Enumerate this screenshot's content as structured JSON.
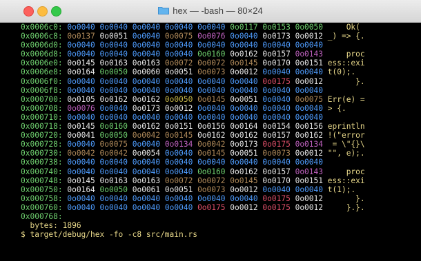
{
  "window": {
    "title": "hex — -bash — 80×24"
  },
  "rows": [
    {
      "addr": "0x0006c0:",
      "bytes": [
        [
          "0o0040",
          "b"
        ],
        [
          "0o0040",
          "b"
        ],
        [
          "0o0040",
          "b"
        ],
        [
          "0o0040",
          "b"
        ],
        [
          "0o0040",
          "b"
        ],
        [
          "0o0117",
          "g"
        ],
        [
          "0o0153",
          "g"
        ],
        [
          "0o0050",
          "g"
        ]
      ],
      "ascii": "    Ok("
    },
    {
      "addr": "0x0006c8:",
      "bytes": [
        [
          "0o0137",
          "o"
        ],
        [
          "0o0051",
          "w"
        ],
        [
          "0o0040",
          "b"
        ],
        [
          "0o0075",
          "o"
        ],
        [
          "0o0076",
          "m"
        ],
        [
          "0o0040",
          "b"
        ],
        [
          "0o0173",
          "w"
        ],
        [
          "0o0012",
          "w"
        ]
      ],
      "ascii": "_) => {."
    },
    {
      "addr": "0x0006d0:",
      "bytes": [
        [
          "0o0040",
          "b"
        ],
        [
          "0o0040",
          "b"
        ],
        [
          "0o0040",
          "b"
        ],
        [
          "0o0040",
          "b"
        ],
        [
          "0o0040",
          "b"
        ],
        [
          "0o0040",
          "b"
        ],
        [
          "0o0040",
          "b"
        ],
        [
          "0o0040",
          "b"
        ]
      ],
      "ascii": ""
    },
    {
      "addr": "0x0006d8:",
      "bytes": [
        [
          "0o0040",
          "b"
        ],
        [
          "0o0040",
          "b"
        ],
        [
          "0o0040",
          "b"
        ],
        [
          "0o0040",
          "b"
        ],
        [
          "0o0160",
          "g"
        ],
        [
          "0o0162",
          "w"
        ],
        [
          "0o0157",
          "w"
        ],
        [
          "0o0143",
          "m"
        ]
      ],
      "ascii": "    proc"
    },
    {
      "addr": "0x0006e0:",
      "bytes": [
        [
          "0o0145",
          "w"
        ],
        [
          "0o0163",
          "w"
        ],
        [
          "0o0163",
          "w"
        ],
        [
          "0o0072",
          "o"
        ],
        [
          "0o0072",
          "o"
        ],
        [
          "0o0145",
          "o"
        ],
        [
          "0o0170",
          "w"
        ],
        [
          "0o0151",
          "w"
        ]
      ],
      "ascii": "ess::exi"
    },
    {
      "addr": "0x0006e8:",
      "bytes": [
        [
          "0o0164",
          "w"
        ],
        [
          "0o0050",
          "g"
        ],
        [
          "0o0060",
          "w"
        ],
        [
          "0o0051",
          "w"
        ],
        [
          "0o0073",
          "o"
        ],
        [
          "0o0012",
          "w"
        ],
        [
          "0o0040",
          "b"
        ],
        [
          "0o0040",
          "b"
        ]
      ],
      "ascii": "t(0);.  "
    },
    {
      "addr": "0x0006f0:",
      "bytes": [
        [
          "0o0040",
          "b"
        ],
        [
          "0o0040",
          "b"
        ],
        [
          "0o0040",
          "b"
        ],
        [
          "0o0040",
          "b"
        ],
        [
          "0o0040",
          "b"
        ],
        [
          "0o0040",
          "b"
        ],
        [
          "0o0175",
          "r"
        ],
        [
          "0o0012",
          "w"
        ]
      ],
      "ascii": "      }."
    },
    {
      "addr": "0x0006f8:",
      "bytes": [
        [
          "0o0040",
          "b"
        ],
        [
          "0o0040",
          "b"
        ],
        [
          "0o0040",
          "b"
        ],
        [
          "0o0040",
          "b"
        ],
        [
          "0o0040",
          "b"
        ],
        [
          "0o0040",
          "b"
        ],
        [
          "0o0040",
          "b"
        ],
        [
          "0o0040",
          "b"
        ]
      ],
      "ascii": ""
    },
    {
      "addr": "0x000700:",
      "bytes": [
        [
          "0o0105",
          "w"
        ],
        [
          "0o0162",
          "w"
        ],
        [
          "0o0162",
          "w"
        ],
        [
          "0o0050",
          "y"
        ],
        [
          "0o0145",
          "o"
        ],
        [
          "0o0051",
          "w"
        ],
        [
          "0o0040",
          "b"
        ],
        [
          "0o0075",
          "o"
        ]
      ],
      "ascii": "Err(e) ="
    },
    {
      "addr": "0x000708:",
      "bytes": [
        [
          "0o0076",
          "m"
        ],
        [
          "0o0040",
          "b"
        ],
        [
          "0o0173",
          "w"
        ],
        [
          "0o0012",
          "w"
        ],
        [
          "0o0040",
          "b"
        ],
        [
          "0o0040",
          "b"
        ],
        [
          "0o0040",
          "b"
        ],
        [
          "0o0040",
          "b"
        ]
      ],
      "ascii": "> {.    "
    },
    {
      "addr": "0x000710:",
      "bytes": [
        [
          "0o0040",
          "b"
        ],
        [
          "0o0040",
          "b"
        ],
        [
          "0o0040",
          "b"
        ],
        [
          "0o0040",
          "b"
        ],
        [
          "0o0040",
          "b"
        ],
        [
          "0o0040",
          "b"
        ],
        [
          "0o0040",
          "b"
        ],
        [
          "0o0040",
          "b"
        ]
      ],
      "ascii": ""
    },
    {
      "addr": "0x000718:",
      "bytes": [
        [
          "0o0145",
          "w"
        ],
        [
          "0o0160",
          "g"
        ],
        [
          "0o0162",
          "w"
        ],
        [
          "0o0151",
          "w"
        ],
        [
          "0o0156",
          "w"
        ],
        [
          "0o0164",
          "w"
        ],
        [
          "0o0154",
          "w"
        ],
        [
          "0o0156",
          "w"
        ]
      ],
      "ascii": "eprintln"
    },
    {
      "addr": "0x000720:",
      "bytes": [
        [
          "0o0041",
          "w"
        ],
        [
          "0o0050",
          "g"
        ],
        [
          "0o0042",
          "o"
        ],
        [
          "0o0145",
          "o"
        ],
        [
          "0o0162",
          "w"
        ],
        [
          "0o0162",
          "w"
        ],
        [
          "0o0157",
          "w"
        ],
        [
          "0o0162",
          "w"
        ]
      ],
      "ascii": "!(\"error"
    },
    {
      "addr": "0x000728:",
      "bytes": [
        [
          "0o0040",
          "b"
        ],
        [
          "0o0075",
          "o"
        ],
        [
          "0o0040",
          "b"
        ],
        [
          "0o0134",
          "m"
        ],
        [
          "0o0042",
          "o"
        ],
        [
          "0o0173",
          "w"
        ],
        [
          "0o0175",
          "r"
        ],
        [
          "0o0134",
          "m"
        ]
      ],
      "ascii": " = \\\"{}\\"
    },
    {
      "addr": "0x000730:",
      "bytes": [
        [
          "0o0042",
          "o"
        ],
        [
          "0o0042",
          "o"
        ],
        [
          "0o0054",
          "w"
        ],
        [
          "0o0040",
          "b"
        ],
        [
          "0o0145",
          "o"
        ],
        [
          "0o0051",
          "w"
        ],
        [
          "0o0073",
          "o"
        ],
        [
          "0o0012",
          "w"
        ]
      ],
      "ascii": "\"\", e);."
    },
    {
      "addr": "0x000738:",
      "bytes": [
        [
          "0o0040",
          "b"
        ],
        [
          "0o0040",
          "b"
        ],
        [
          "0o0040",
          "b"
        ],
        [
          "0o0040",
          "b"
        ],
        [
          "0o0040",
          "b"
        ],
        [
          "0o0040",
          "b"
        ],
        [
          "0o0040",
          "b"
        ],
        [
          "0o0040",
          "b"
        ]
      ],
      "ascii": ""
    },
    {
      "addr": "0x000740:",
      "bytes": [
        [
          "0o0040",
          "b"
        ],
        [
          "0o0040",
          "b"
        ],
        [
          "0o0040",
          "b"
        ],
        [
          "0o0040",
          "b"
        ],
        [
          "0o0160",
          "g"
        ],
        [
          "0o0162",
          "w"
        ],
        [
          "0o0157",
          "w"
        ],
        [
          "0o0143",
          "m"
        ]
      ],
      "ascii": "    proc"
    },
    {
      "addr": "0x000748:",
      "bytes": [
        [
          "0o0145",
          "w"
        ],
        [
          "0o0163",
          "w"
        ],
        [
          "0o0163",
          "w"
        ],
        [
          "0o0072",
          "o"
        ],
        [
          "0o0072",
          "o"
        ],
        [
          "0o0145",
          "o"
        ],
        [
          "0o0170",
          "w"
        ],
        [
          "0o0151",
          "w"
        ]
      ],
      "ascii": "ess::exi"
    },
    {
      "addr": "0x000750:",
      "bytes": [
        [
          "0o0164",
          "w"
        ],
        [
          "0o0050",
          "g"
        ],
        [
          "0o0061",
          "w"
        ],
        [
          "0o0051",
          "w"
        ],
        [
          "0o0073",
          "o"
        ],
        [
          "0o0012",
          "w"
        ],
        [
          "0o0040",
          "b"
        ],
        [
          "0o0040",
          "b"
        ]
      ],
      "ascii": "t(1);.  "
    },
    {
      "addr": "0x000758:",
      "bytes": [
        [
          "0o0040",
          "b"
        ],
        [
          "0o0040",
          "b"
        ],
        [
          "0o0040",
          "b"
        ],
        [
          "0o0040",
          "b"
        ],
        [
          "0o0040",
          "b"
        ],
        [
          "0o0040",
          "b"
        ],
        [
          "0o0175",
          "r"
        ],
        [
          "0o0012",
          "w"
        ]
      ],
      "ascii": "      }."
    },
    {
      "addr": "0x000760:",
      "bytes": [
        [
          "0o0040",
          "b"
        ],
        [
          "0o0040",
          "b"
        ],
        [
          "0o0040",
          "b"
        ],
        [
          "0o0040",
          "b"
        ],
        [
          "0o0175",
          "r"
        ],
        [
          "0o0012",
          "w"
        ],
        [
          "0o0175",
          "r"
        ],
        [
          "0o0012",
          "w"
        ]
      ],
      "ascii": "    }.}."
    },
    {
      "addr": "0x000768:",
      "bytes": [],
      "ascii": ""
    }
  ],
  "footer": {
    "bytes_label": "  bytes: 1896",
    "prompt": "$ target/debug/hex -fo -c8 src/main.rs"
  },
  "colors": {
    "b": "#4f9dff",
    "w": "#e8e8e8",
    "g": "#6fd06f",
    "y": "#c9b94a",
    "m": "#c062c0",
    "o": "#b08a5a",
    "r": "#e0506a"
  }
}
